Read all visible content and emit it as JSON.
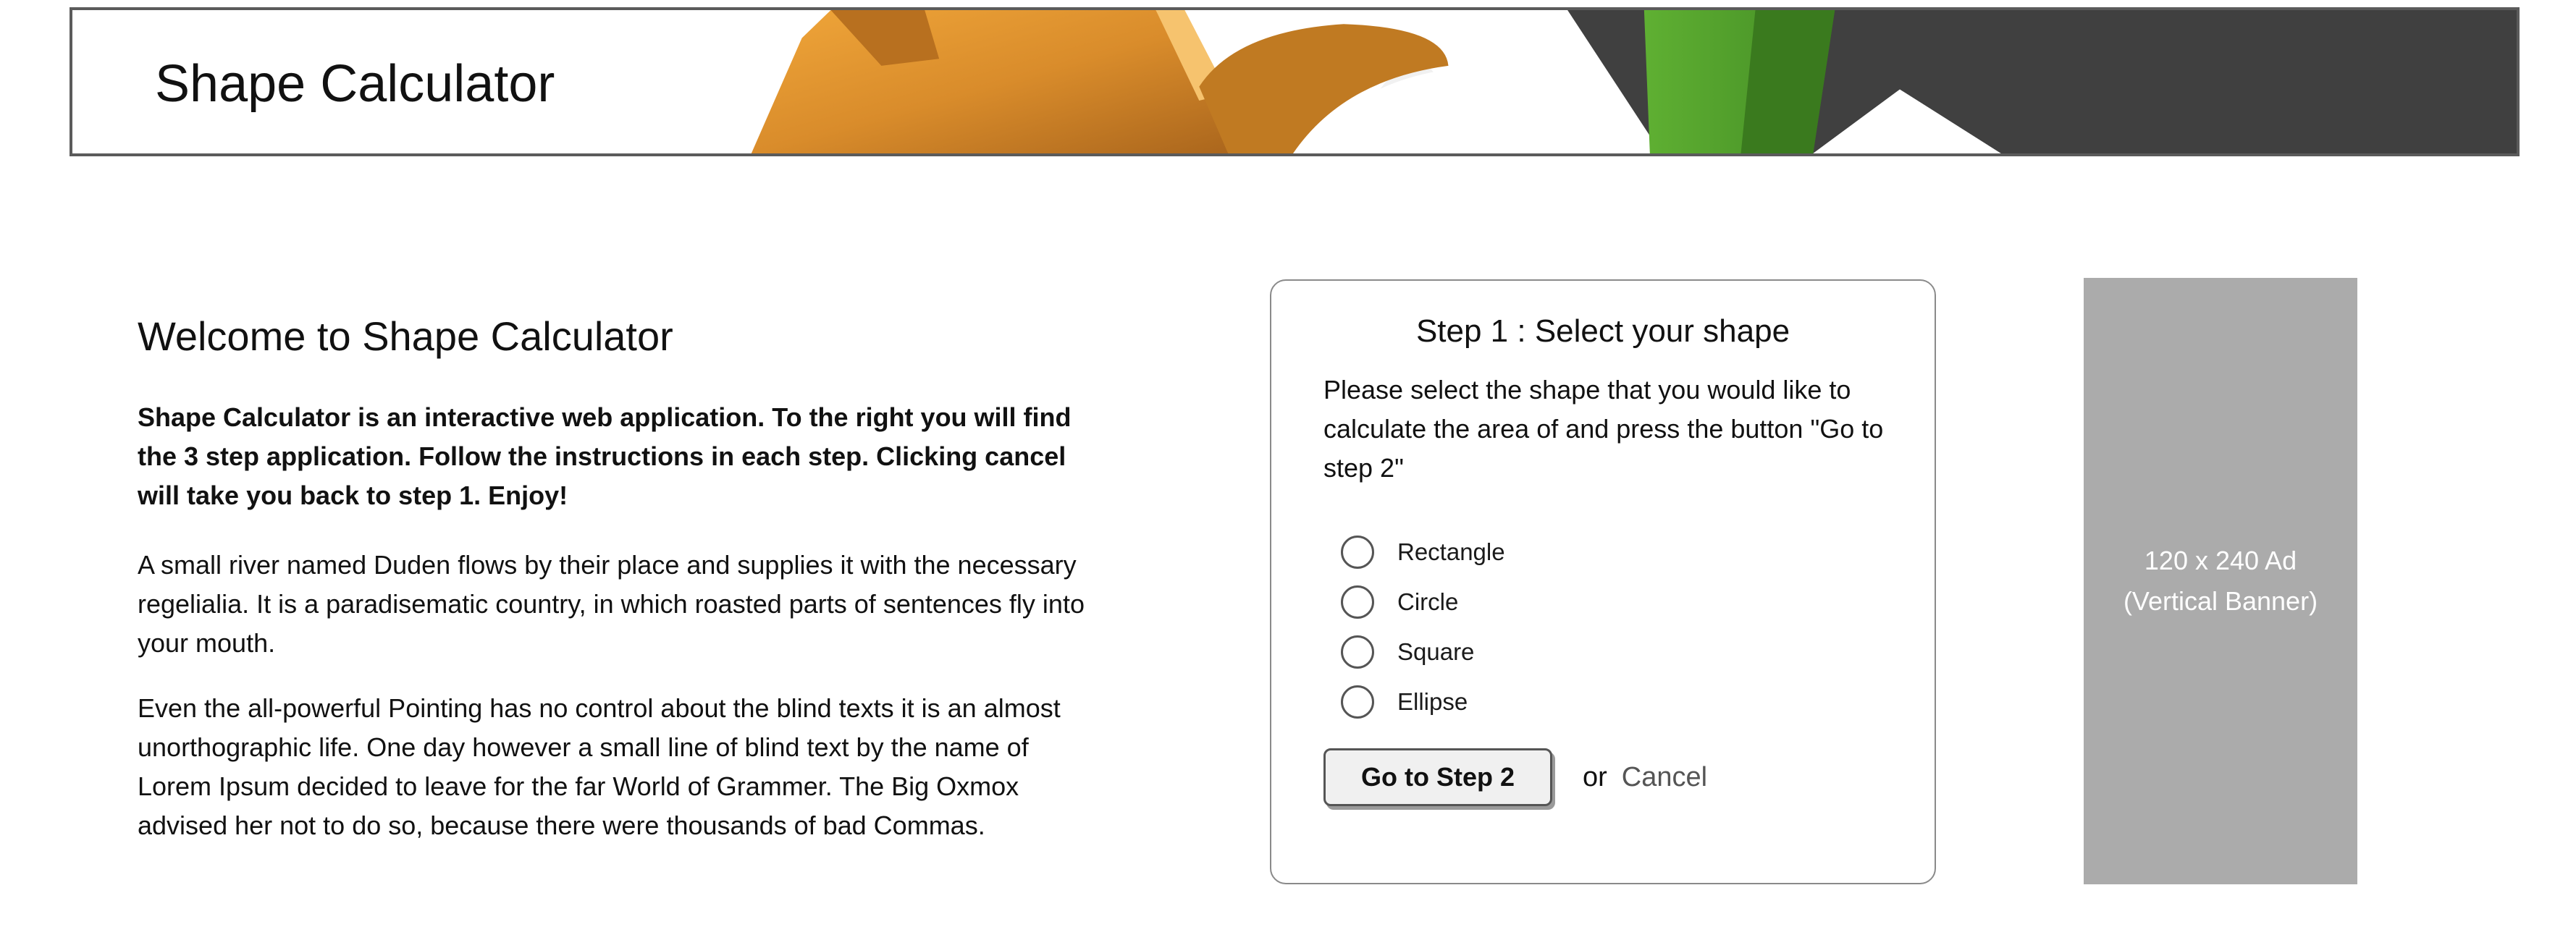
{
  "header": {
    "app_title": "Shape Calculator"
  },
  "intro": {
    "heading": "Welcome to Shape Calculator",
    "lead": "Shape Calculator is an interactive web application. To the right you will find the 3 step application. Follow the instructions in each step. Clicking cancel will take you back to step 1. Enjoy!",
    "paragraphs": [
      "A small river named Duden flows by their place and supplies it with the necessary regelialia. It is a paradisematic country, in which roasted parts of sentences fly into your mouth.",
      "Even the all-powerful Pointing has no control about the blind texts it is an almost unorthographic life. One day however a small line of blind text by the name of Lorem Ipsum decided to leave for the far World of Grammer. The Big Oxmox advised her not to do so, because there were thousands of bad Commas."
    ]
  },
  "step": {
    "title": "Step 1 : Select your shape",
    "description": "Please select the shape that you would like to calculate the area of and press the button \"Go to step 2\"",
    "options": [
      {
        "label": "Rectangle",
        "selected": false
      },
      {
        "label": "Circle",
        "selected": false
      },
      {
        "label": "Square",
        "selected": false
      },
      {
        "label": "Ellipse",
        "selected": false
      }
    ],
    "go_button": "Go to Step 2",
    "or_text": "or",
    "cancel_link": "Cancel"
  },
  "ad": {
    "line1": "120 x 240 Ad",
    "line2": "(Vertical Banner)"
  },
  "colors": {
    "banner_orange": "#d98c2b",
    "banner_green": "#4e9a2a",
    "banner_dark": "#404040",
    "ad_gray": "#ababab",
    "panel_border": "#8a8a8a"
  }
}
